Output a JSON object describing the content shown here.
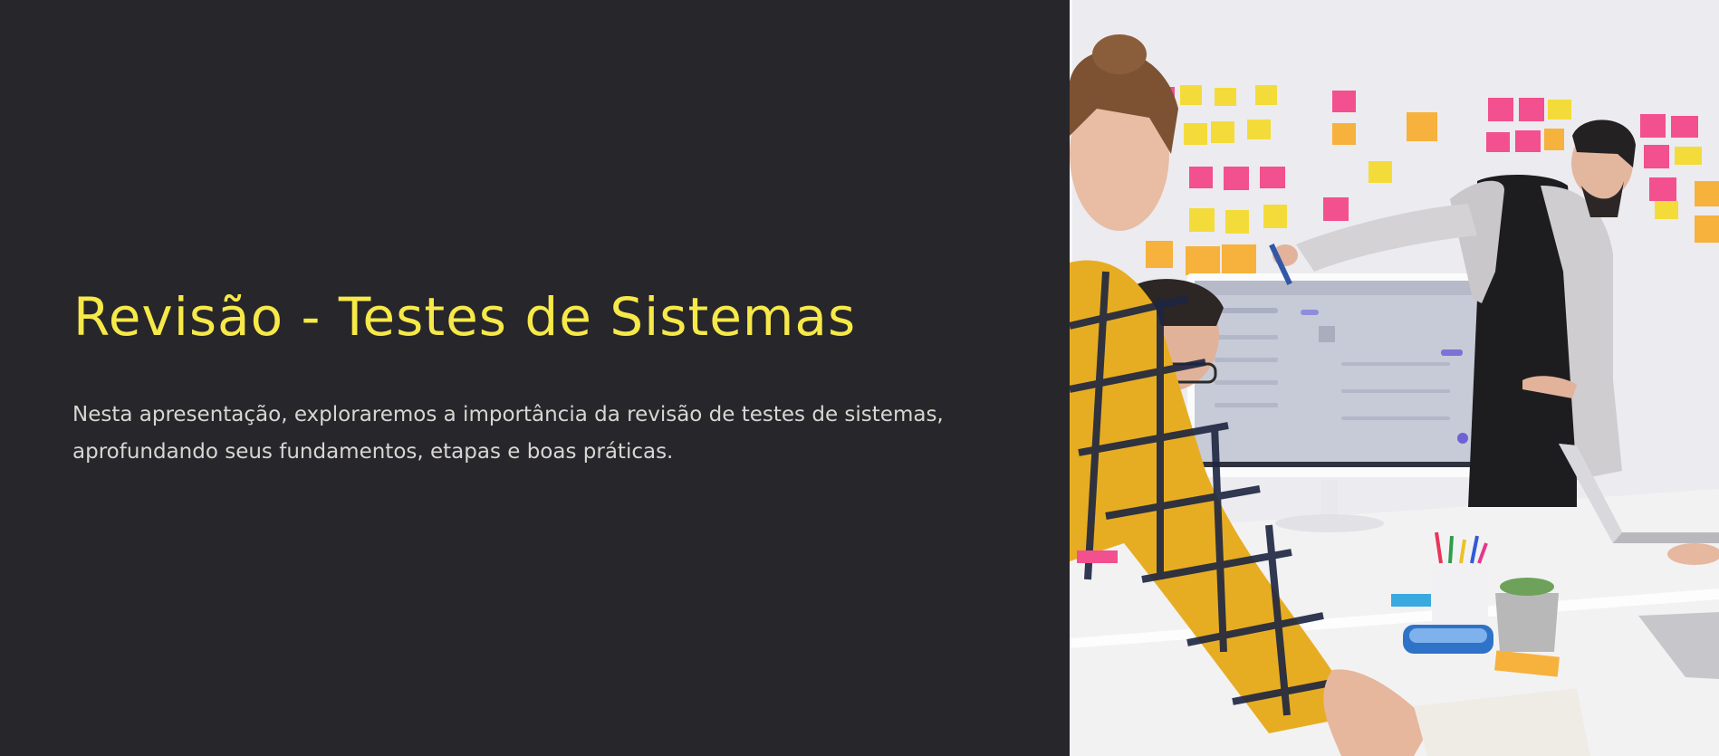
{
  "slide": {
    "title": "Revisão - Testes de Sistemas",
    "description": "Nesta apresentação, exploraremos a importância da revisão de testes de sistemas, aprofundando seus fundamentos, etapas e boas práticas."
  },
  "colors": {
    "background": "#27262b",
    "title": "#f6e948",
    "text": "#d8d6d2",
    "sticky_pink": "#f2508f",
    "sticky_yellow": "#f3dc3a",
    "sticky_orange": "#f6b23c"
  }
}
